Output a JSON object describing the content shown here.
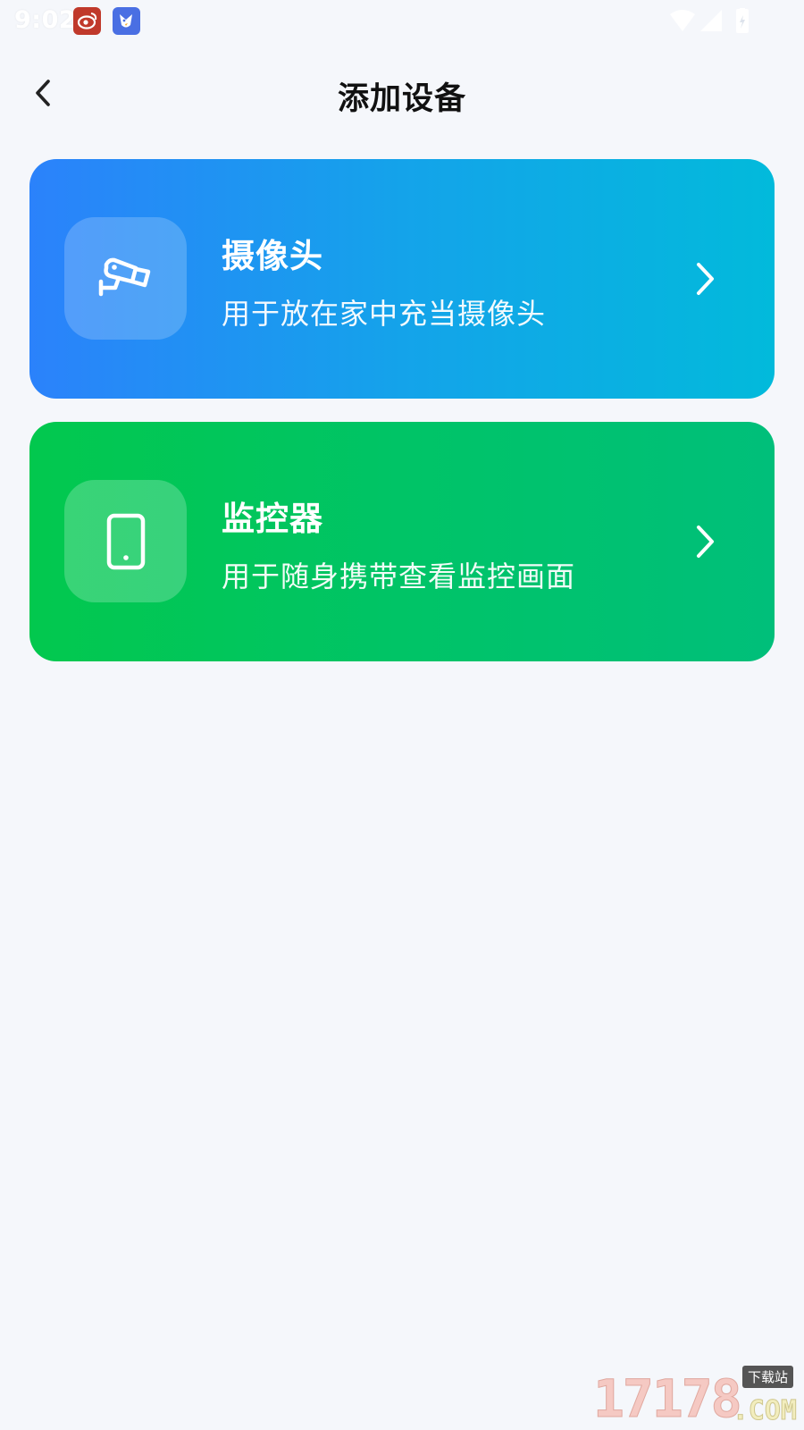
{
  "status_bar": {
    "time": "9:02",
    "notification_icons": [
      "weibo-icon",
      "bird-app-icon"
    ],
    "right_icons": [
      "wifi-icon",
      "cell-signal-icon",
      "battery-icon"
    ]
  },
  "nav": {
    "title": "添加设备",
    "back_icon": "chevron-left-icon"
  },
  "cards": [
    {
      "title": "摄像头",
      "desc": "用于放在家中充当摄像头",
      "icon": "security-camera-icon",
      "colors": [
        "#2B82FB",
        "#02BADB"
      ]
    },
    {
      "title": "监控器",
      "desc": "用于随身携带查看监控画面",
      "icon": "smartphone-icon",
      "colors": [
        "#02C84E",
        "#00BF7A"
      ]
    }
  ],
  "watermark": {
    "digits": "17178",
    "tag": "下载站",
    "domain": ".COM"
  }
}
